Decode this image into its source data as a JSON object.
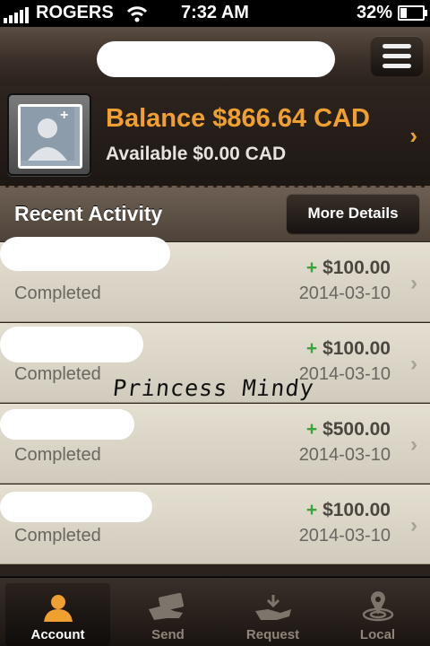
{
  "status_bar": {
    "carrier": "ROGERS",
    "time": "7:32 AM",
    "battery": "32%",
    "battery_level": 0.32
  },
  "header": {
    "menu_icon": "hamburger-menu-icon"
  },
  "balance": {
    "title": "Balance $866.64 CAD",
    "available": "Available $0.00 CAD",
    "avatar_icon": "user-profile-placeholder-icon",
    "accent_color": "#f0a030"
  },
  "recent": {
    "title": "Recent Activity",
    "more_label": "More Details",
    "rows": [
      {
        "status": "Completed",
        "sign": "+",
        "amount": "$100.00",
        "date": "2014-03-10"
      },
      {
        "status": "Completed",
        "sign": "+",
        "amount": "$100.00",
        "date": "2014-03-10"
      },
      {
        "status": "Completed",
        "sign": "+",
        "amount": "$500.00",
        "date": "2014-03-10"
      },
      {
        "status": "Completed",
        "sign": "+",
        "amount": "$100.00",
        "date": "2014-03-10"
      }
    ]
  },
  "watermark": "Princess Mindy",
  "tabs": [
    {
      "label": "Account",
      "icon": "account-person-icon",
      "active": true
    },
    {
      "label": "Send",
      "icon": "send-money-icon",
      "active": false
    },
    {
      "label": "Request",
      "icon": "request-money-icon",
      "active": false
    },
    {
      "label": "Local",
      "icon": "local-pin-icon",
      "active": false
    }
  ]
}
